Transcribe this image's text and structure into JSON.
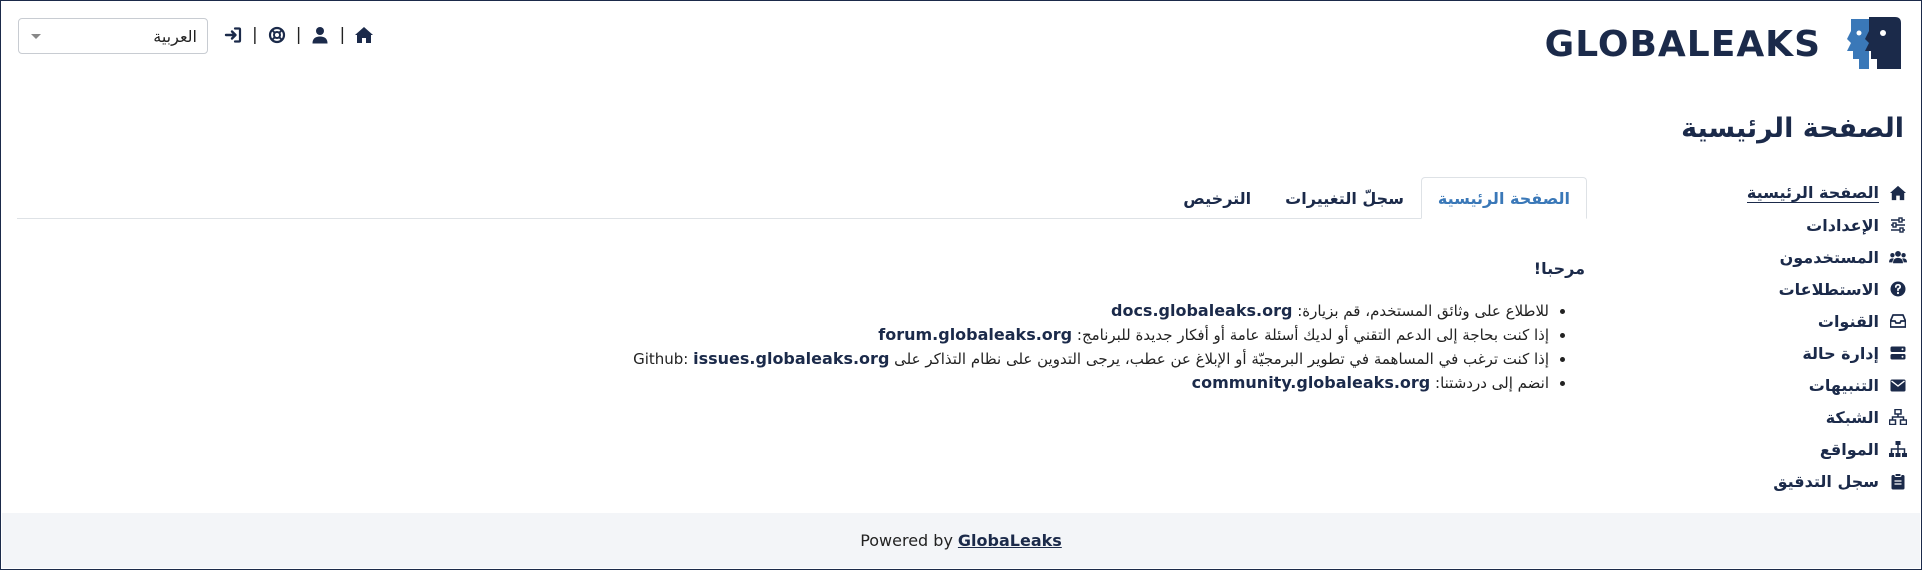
{
  "header": {
    "logo_text": "GLOBALEAKS",
    "logo_icon": "globaleaks-faces-logo",
    "language": {
      "selected": "العربية"
    },
    "icons": [
      "home-icon",
      "user-icon",
      "support-icon",
      "logout-icon"
    ],
    "separator": "|"
  },
  "page": {
    "title": "الصفحة الرئيسية"
  },
  "sidebar": {
    "items": [
      {
        "label": "الصفحة الرئيسية",
        "icon": "home-icon",
        "active": true
      },
      {
        "label": "الإعدادات",
        "icon": "sliders-icon"
      },
      {
        "label": "المستخدمون",
        "icon": "users-icon"
      },
      {
        "label": "الاستطلاعات",
        "icon": "question-icon"
      },
      {
        "label": "القنوات",
        "icon": "inbox-icon"
      },
      {
        "label": "إدارة حالة",
        "icon": "server-icon"
      },
      {
        "label": "التنبيهات",
        "icon": "envelope-icon"
      },
      {
        "label": "الشبكة",
        "icon": "network-icon"
      },
      {
        "label": "المواقع",
        "icon": "sitemap-icon"
      },
      {
        "label": "سجل التدقيق",
        "icon": "clipboard-icon"
      }
    ]
  },
  "tabs": [
    {
      "label": "الصفحة الرئيسية",
      "active": true
    },
    {
      "label": "سجلّ التغييرات"
    },
    {
      "label": "الترخيص"
    }
  ],
  "main": {
    "welcome": "مرحبا!",
    "items": [
      {
        "text": "للاطلاع على وثائق المستخدم، قم بزيارة: ",
        "link": "docs.globaleaks.org",
        "suffix": ""
      },
      {
        "text": "إذا كنت بحاجة إلى الدعم التقني أو لديك أسئلة عامة أو أفكار جديدة للبرنامج: ",
        "link": "forum.globaleaks.org",
        "suffix": ""
      },
      {
        "text": "إذا كنت ترغب في المساهمة في تطوير البرمجيّة أو الإبلاغ عن عطب، يرجى التدوين على نظام التذاكر على Github: ",
        "link": "issues.globaleaks.org",
        "suffix": ""
      },
      {
        "text": "انضم إلى دردشتنا: ",
        "link": "community.globaleaks.org",
        "suffix": ""
      }
    ]
  },
  "footer": {
    "prefix": "Powered by",
    "brand": "GlobaLeaks"
  },
  "colors": {
    "navy": "#1b2a4a",
    "accent": "#3a78b8",
    "footer_bg": "#f3f5f8"
  }
}
